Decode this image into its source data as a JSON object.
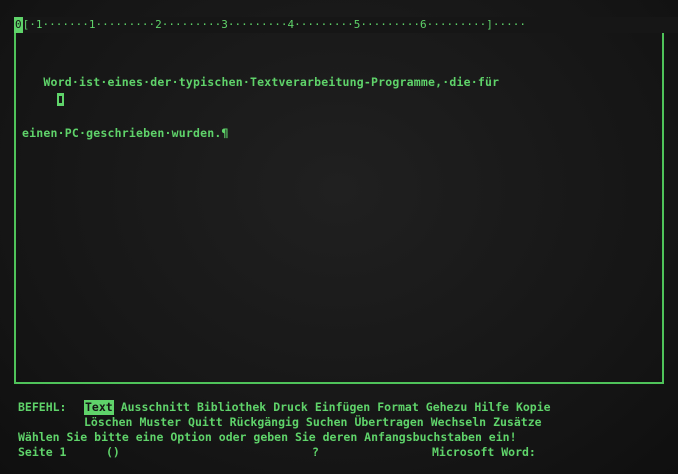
{
  "ruler": {
    "marker": "0",
    "text": "[·1·······1·········2·········3·········4·········5·········6·········]·····"
  },
  "document": {
    "line1": "   Word·ist·eines·der·typischen·Textverarbeitung-Programme,·die·für",
    "line2": "einen·PC·geschrieben·wurden.¶"
  },
  "command_menu": {
    "label": "BEFEHL:",
    "row1": [
      "Text",
      "Ausschnitt",
      "Bibliothek",
      "Druck",
      "Einfügen",
      "Format",
      "Gehezu",
      "Hilfe",
      "Kopie"
    ],
    "row2": [
      "Löschen",
      "Muster",
      "Quitt",
      "Rückgängig",
      "Suchen",
      "Übertragen",
      "Wechseln",
      "Zusätze"
    ]
  },
  "message": "Wählen Sie bitte eine Option oder geben Sie deren Anfangsbuchstaben ein!",
  "status": {
    "page": "Seite 1",
    "paren": "()",
    "question": "?",
    "app": "Microsoft Word:"
  },
  "colors": {
    "phosphor": "#5fd36a",
    "background": "#161616"
  }
}
